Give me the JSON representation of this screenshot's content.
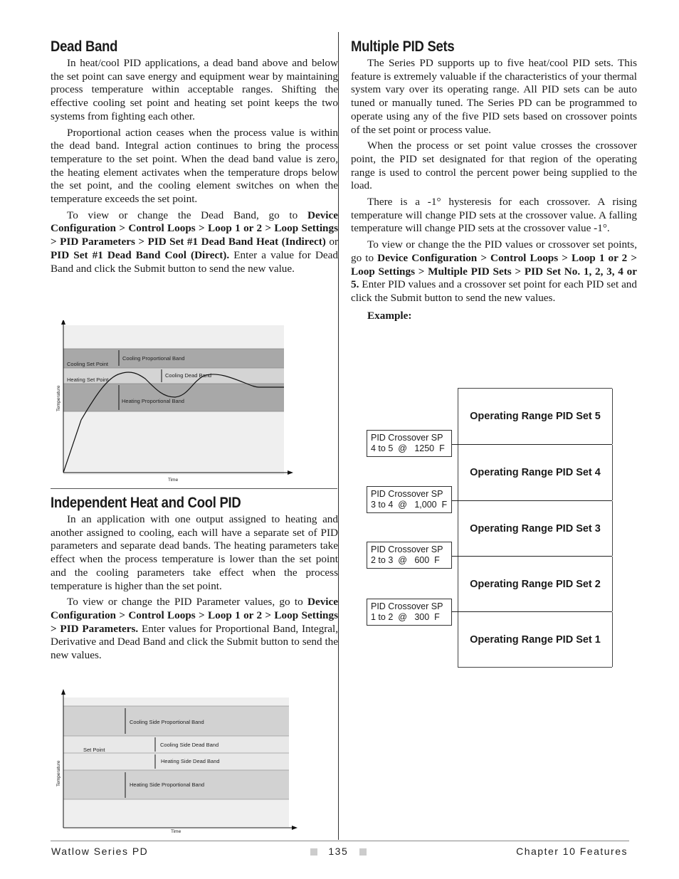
{
  "left_column": {
    "dead_band": {
      "heading": "Dead Band",
      "p1": "In heat/cool PID applications, a dead band above and below the set point can save energy and equipment wear by maintaining process temperature within acceptable ranges. Shifting the effective cooling set point and heating set point keeps the two systems from fighting each other.",
      "p2": "Proportional action ceases when the process value is within the dead band. Integral action continues to bring the process temperature to the set point. When the dead band value is zero, the heating element activates when the temperature drops below the set point, and the cooling element switches on when the temperature exceeds the set point.",
      "p3_pre": "To view or change the Dead Band, go to ",
      "p3_bold1": "Device Configuration > Control Loops > Loop 1 or 2 > Loop Settings > PID Parameters > PID Set #1 Dead Band Heat (Indirect)",
      "p3_mid": " or ",
      "p3_bold2": "PID Set #1 Dead Band Cool (Direct).",
      "p3_post": " Enter a value for Dead Band and click the Submit button to send the new value."
    },
    "figure1": {
      "y_label": "Temperature",
      "x_label": "Time",
      "cooling_set_point": "Cooling Set Point",
      "heating_set_point": "Heating Set Point",
      "cooling_prop_band": "Cooling Proportional Band",
      "cooling_dead_band": "Cooling Dead Band",
      "heating_prop_band": "Heating Proportional Band"
    },
    "independent": {
      "heading": "Independent Heat and Cool PID",
      "p1": "In an application with one output assigned to heating and another assigned to cooling, each will have a separate set of PID parameters and separate dead bands. The heating parameters take effect when the process temperature is lower than the set point and the cooling parameters take effect when the process temperature is higher than the set point.",
      "p2_pre": "To view or change the PID Parameter values, go to ",
      "p2_bold": "Device Configuration > Control Loops > Loop 1 or 2 > Loop Settings > PID Parameters.",
      "p2_post": " Enter values for Proportional Band, Integral, Derivative and Dead Band and click the Submit button to send the new values."
    },
    "figure2": {
      "y_label": "Temperature",
      "x_label": "Time",
      "set_point": "Set Point",
      "cooling_side_prop_band": "Cooling Side Proportional Band",
      "cooling_side_dead_band": "Cooling Side Dead Band",
      "heating_side_dead_band": "Heating Side Dead Band",
      "heating_side_prop_band": "Heating Side Proportional Band"
    }
  },
  "right_column": {
    "multiple": {
      "heading": "Multiple PID Sets",
      "p1": "The Series PD supports up to five heat/cool PID sets. This feature is extremely valuable if the characteristics of your thermal system vary over its operating range. All PID sets can be auto tuned or manually tuned. The Series PD can be programmed to operate using any of the five PID sets based on crossover points of the set point or process value.",
      "p2": "When the process or set point value crosses the crossover point, the PID set designated for that region of the operating range is used to control the percent power being supplied to the load.",
      "p3": "There is a -1° hysteresis for each crossover. A rising temperature will change PID sets at the crossover value. A falling temperature will change PID sets at the crossover value -1°.",
      "p4_pre": "To view or change the the PID values or crossover set points, go to ",
      "p4_bold": "Device Configuration > Control Loops > Loop 1 or 2 > Loop Settings > Multiple PID Sets > PID Set No. 1, 2, 3, 4 or 5.",
      "p4_post": " Enter PID values and a crossover set point for each PID set and click the Submit button to send the new values.",
      "example_label": "Example:"
    },
    "example": {
      "ranges": [
        "Operating Range PID Set 5",
        "Operating Range PID Set 4",
        "Operating Range PID Set 3",
        "Operating Range PID Set 2",
        "Operating Range PID Set 1"
      ],
      "crossovers": [
        "PID Crossover SP\n4 to 5  @   1250  F",
        "PID Crossover SP\n3 to 4  @   1,000  F",
        "PID Crossover SP\n2 to 3  @   600  F",
        "PID Crossover SP\n1 to 2  @   300  F"
      ]
    }
  },
  "footer": {
    "left": "Watlow Series PD",
    "page": "135",
    "right": "Chapter 10 Features"
  }
}
